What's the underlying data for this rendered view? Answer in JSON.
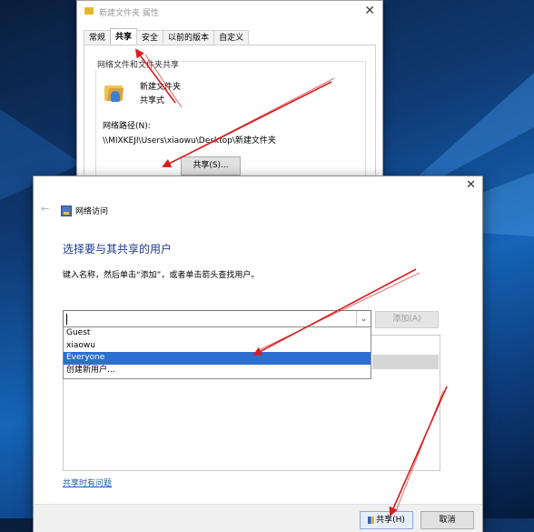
{
  "properties_window": {
    "title": "新建文件夹 属性",
    "tabs": [
      {
        "label": "常规",
        "active": false
      },
      {
        "label": "共享",
        "active": true
      },
      {
        "label": "安全",
        "active": false
      },
      {
        "label": "以前的版本",
        "active": false
      },
      {
        "label": "自定义",
        "active": false
      }
    ],
    "group_title": "网络文件和文件夹共享",
    "folder_name": "新建文件夹",
    "folder_state": "共享式",
    "network_path_label": "网络路径(N):",
    "network_path_value": "\\\\MIXKEJI\\Users\\xiaowu\\Desktop\\新建文件夹",
    "share_button": "共享(S)..."
  },
  "share_dialog": {
    "breadcrumb": "网络访问",
    "heading": "选择要与其共享的用户",
    "instruction": "键入名称，然后单击“添加”，或者单击箭头查找用户。",
    "input_value": "",
    "add_button": "添加(A)",
    "dropdown_options": [
      {
        "label": "Guest",
        "selected": false
      },
      {
        "label": "xiaowu",
        "selected": false
      },
      {
        "label": "Everyone",
        "selected": true
      },
      {
        "label": "创建新用户...",
        "selected": false
      }
    ],
    "help_link": "共享时有问题",
    "share_button": "共享(H)",
    "cancel_button": "取消"
  },
  "colors": {
    "accent_selection": "#2d6fcf",
    "heading": "#1e3a8a",
    "annotation_arrow": "#d81e1e"
  }
}
